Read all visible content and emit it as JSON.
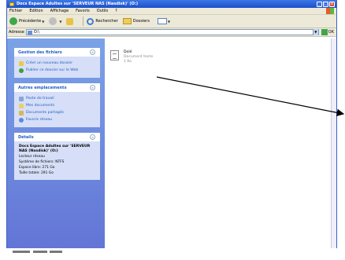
{
  "window": {
    "title": "Docs Espace Adultes sur 'SERVEUR NAS (Nasdisk)' (O:)",
    "controls": [
      "_",
      "□",
      "x"
    ]
  },
  "menu": [
    "Fichier",
    "Edition",
    "Affichage",
    "Favoris",
    "Outils",
    "?"
  ],
  "toolbar": {
    "back_label": "Précédente",
    "search_label": "Rechercher",
    "folders_label": "Dossiers"
  },
  "address": {
    "label": "Adresse",
    "value": "O:\\",
    "go_label": "OK"
  },
  "sidebar": {
    "file_tasks": {
      "title": "Gestion des fichiers",
      "items": [
        {
          "label": "Créer un nouveau dossier",
          "icon": "new-folder-icon"
        },
        {
          "label": "Publier ce dossier sur le Web",
          "icon": "web-publish-icon"
        }
      ]
    },
    "other_places": {
      "title": "Autres emplacements",
      "items": [
        {
          "label": "Poste de travail",
          "icon": "my-computer-icon"
        },
        {
          "label": "Mes documents",
          "icon": "my-documents-icon"
        },
        {
          "label": "Documents partagés",
          "icon": "shared-documents-icon"
        },
        {
          "label": "Favoris réseau",
          "icon": "network-places-icon"
        }
      ]
    },
    "details": {
      "title": "Détails",
      "name": "Docs Espace Adultes sur 'SERVEUR NAS (Nasdisk)' (O:)",
      "type": "Lecteur réseau",
      "filesystem": "Système de fichiers: NTFS",
      "free": "Espace libre: 271 Go",
      "total": "Taille totale: 291 Go"
    }
  },
  "content": {
    "file": {
      "name": "Dolé",
      "type": "Document texte",
      "size": "1 Ko"
    }
  },
  "colors": {
    "title_bar": "#1c4fc9",
    "sidebar": "#6375d6",
    "link": "#215dc6"
  }
}
